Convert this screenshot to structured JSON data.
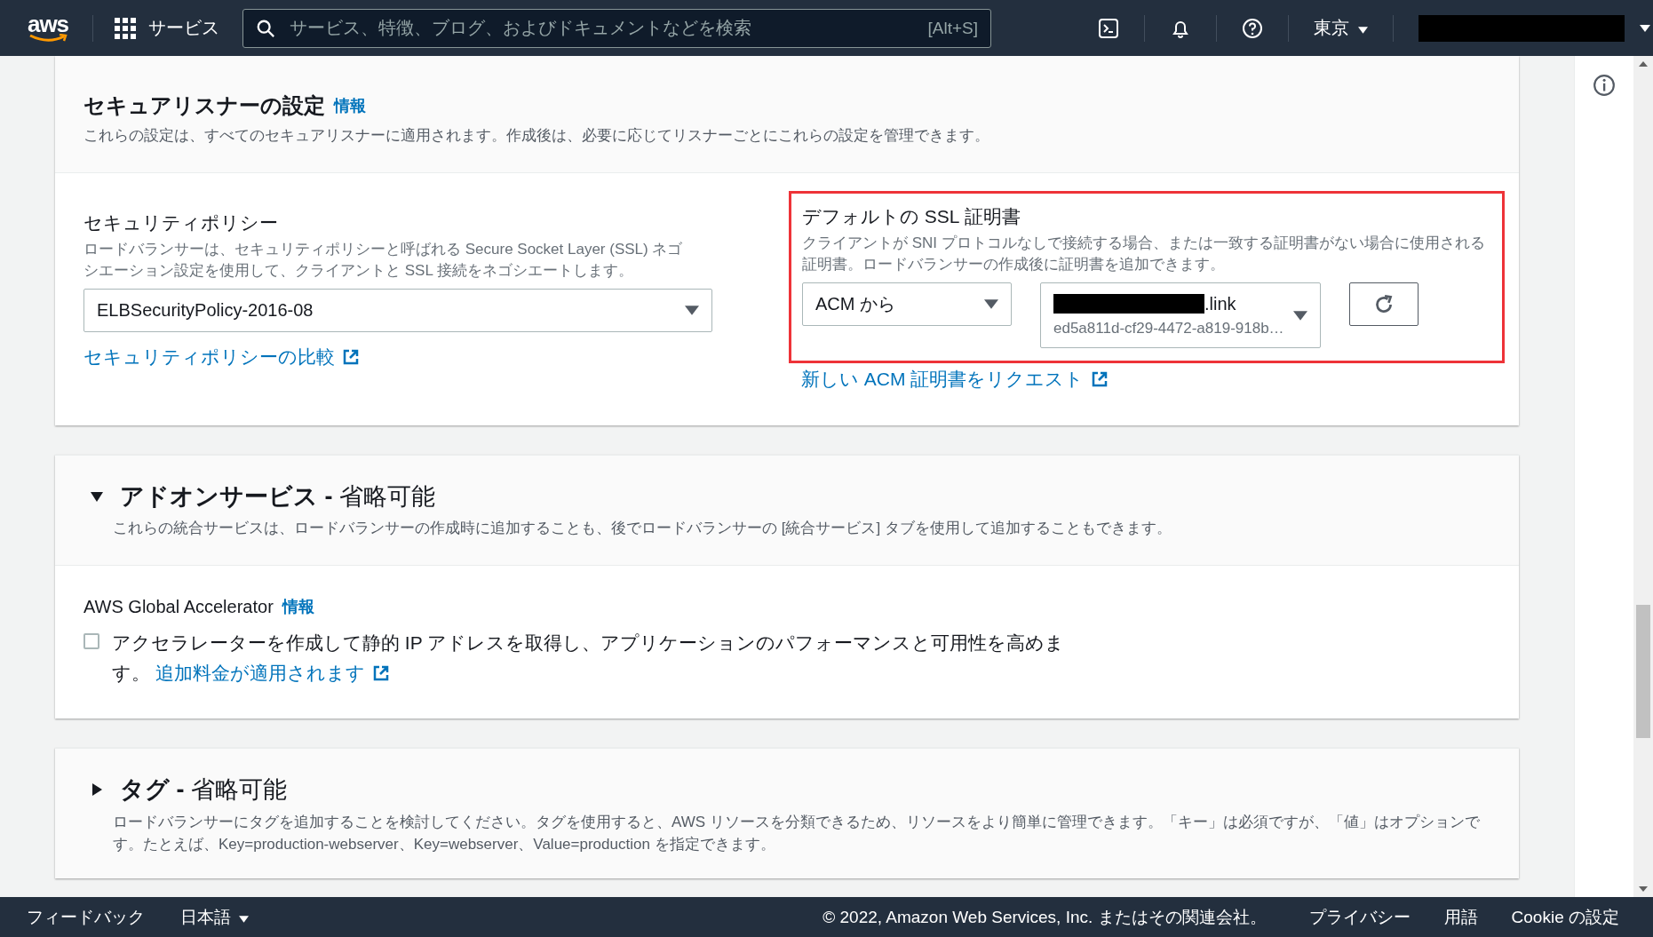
{
  "top_bar": {
    "logo_text": "aws",
    "services_label": "サービス",
    "search": {
      "placeholder": "サービス、特徴、ブログ、およびドキュメントなどを検索",
      "shortcut": "[Alt+S]"
    },
    "region": "東京"
  },
  "listener_settings": {
    "title": "セキュアリスナーの設定",
    "info_link": "情報",
    "description": "これらの設定は、すべてのセキュアリスナーに適用されます。作成後は、必要に応じてリスナーごとにこれらの設定を管理できます。",
    "security_policy": {
      "label": "セキュリティポリシー",
      "description": "ロードバランサーは、セキュリティポリシーと呼ばれる Secure Socket Layer (SSL) ネゴシエーション設定を使用して、クライアントと SSL 接続をネゴシエートします。",
      "value": "ELBSecurityPolicy-2016-08",
      "compare_link": "セキュリティポリシーの比較"
    },
    "default_certificate": {
      "highlighted": true,
      "label": "デフォルトの SSL 証明書",
      "description": "クライアントが SNI プロトコルなしで接続する場合、または一致する証明書がない場合に使用される証明書。ロードバランサーの作成後に証明書を追加できます。",
      "source": "ACM から",
      "certificate": {
        "name_suffix": ".link",
        "id": "ed5a811d-cf29-4472-a819-918b…"
      },
      "request_link": "新しい ACM 証明書をリクエスト"
    }
  },
  "addon_services": {
    "expanded": true,
    "title": "**アドオンサービス -** 省略可能",
    "description": "これらの統合サービスは、ロードバランサーの作成時に追加することも、後でロードバランサーの [統合サービス] タブを使用して追加することもできます。",
    "global_accelerator": {
      "label": "AWS Global Accelerator",
      "info_link": "情報",
      "checked": false,
      "text": "アクセラレーターを作成して静的 IP アドレスを取得し、アプリケーションのパフォーマンスと可用性を高めます。",
      "fee_link": "追加料金が適用されます"
    }
  },
  "tags": {
    "expanded": false,
    "title": "**タグ -** 省略可能",
    "description": "ロードバランサーにタグを追加することを検討してください。タグを使用すると、AWS リソースを分類できるため、リソースをより簡単に管理できます。「キー」は必須ですが、「値」はオプションです。たとえば、Key=production-webserver、Key=webserver、Value=production を指定できます。"
  },
  "footer": {
    "feedback": "フィードバック",
    "language": "日本語",
    "copyright": "© 2022, Amazon Web Services, Inc. またはその関連会社。",
    "links": [
      "プライバシー",
      "用語",
      "Cookie の設定"
    ]
  }
}
